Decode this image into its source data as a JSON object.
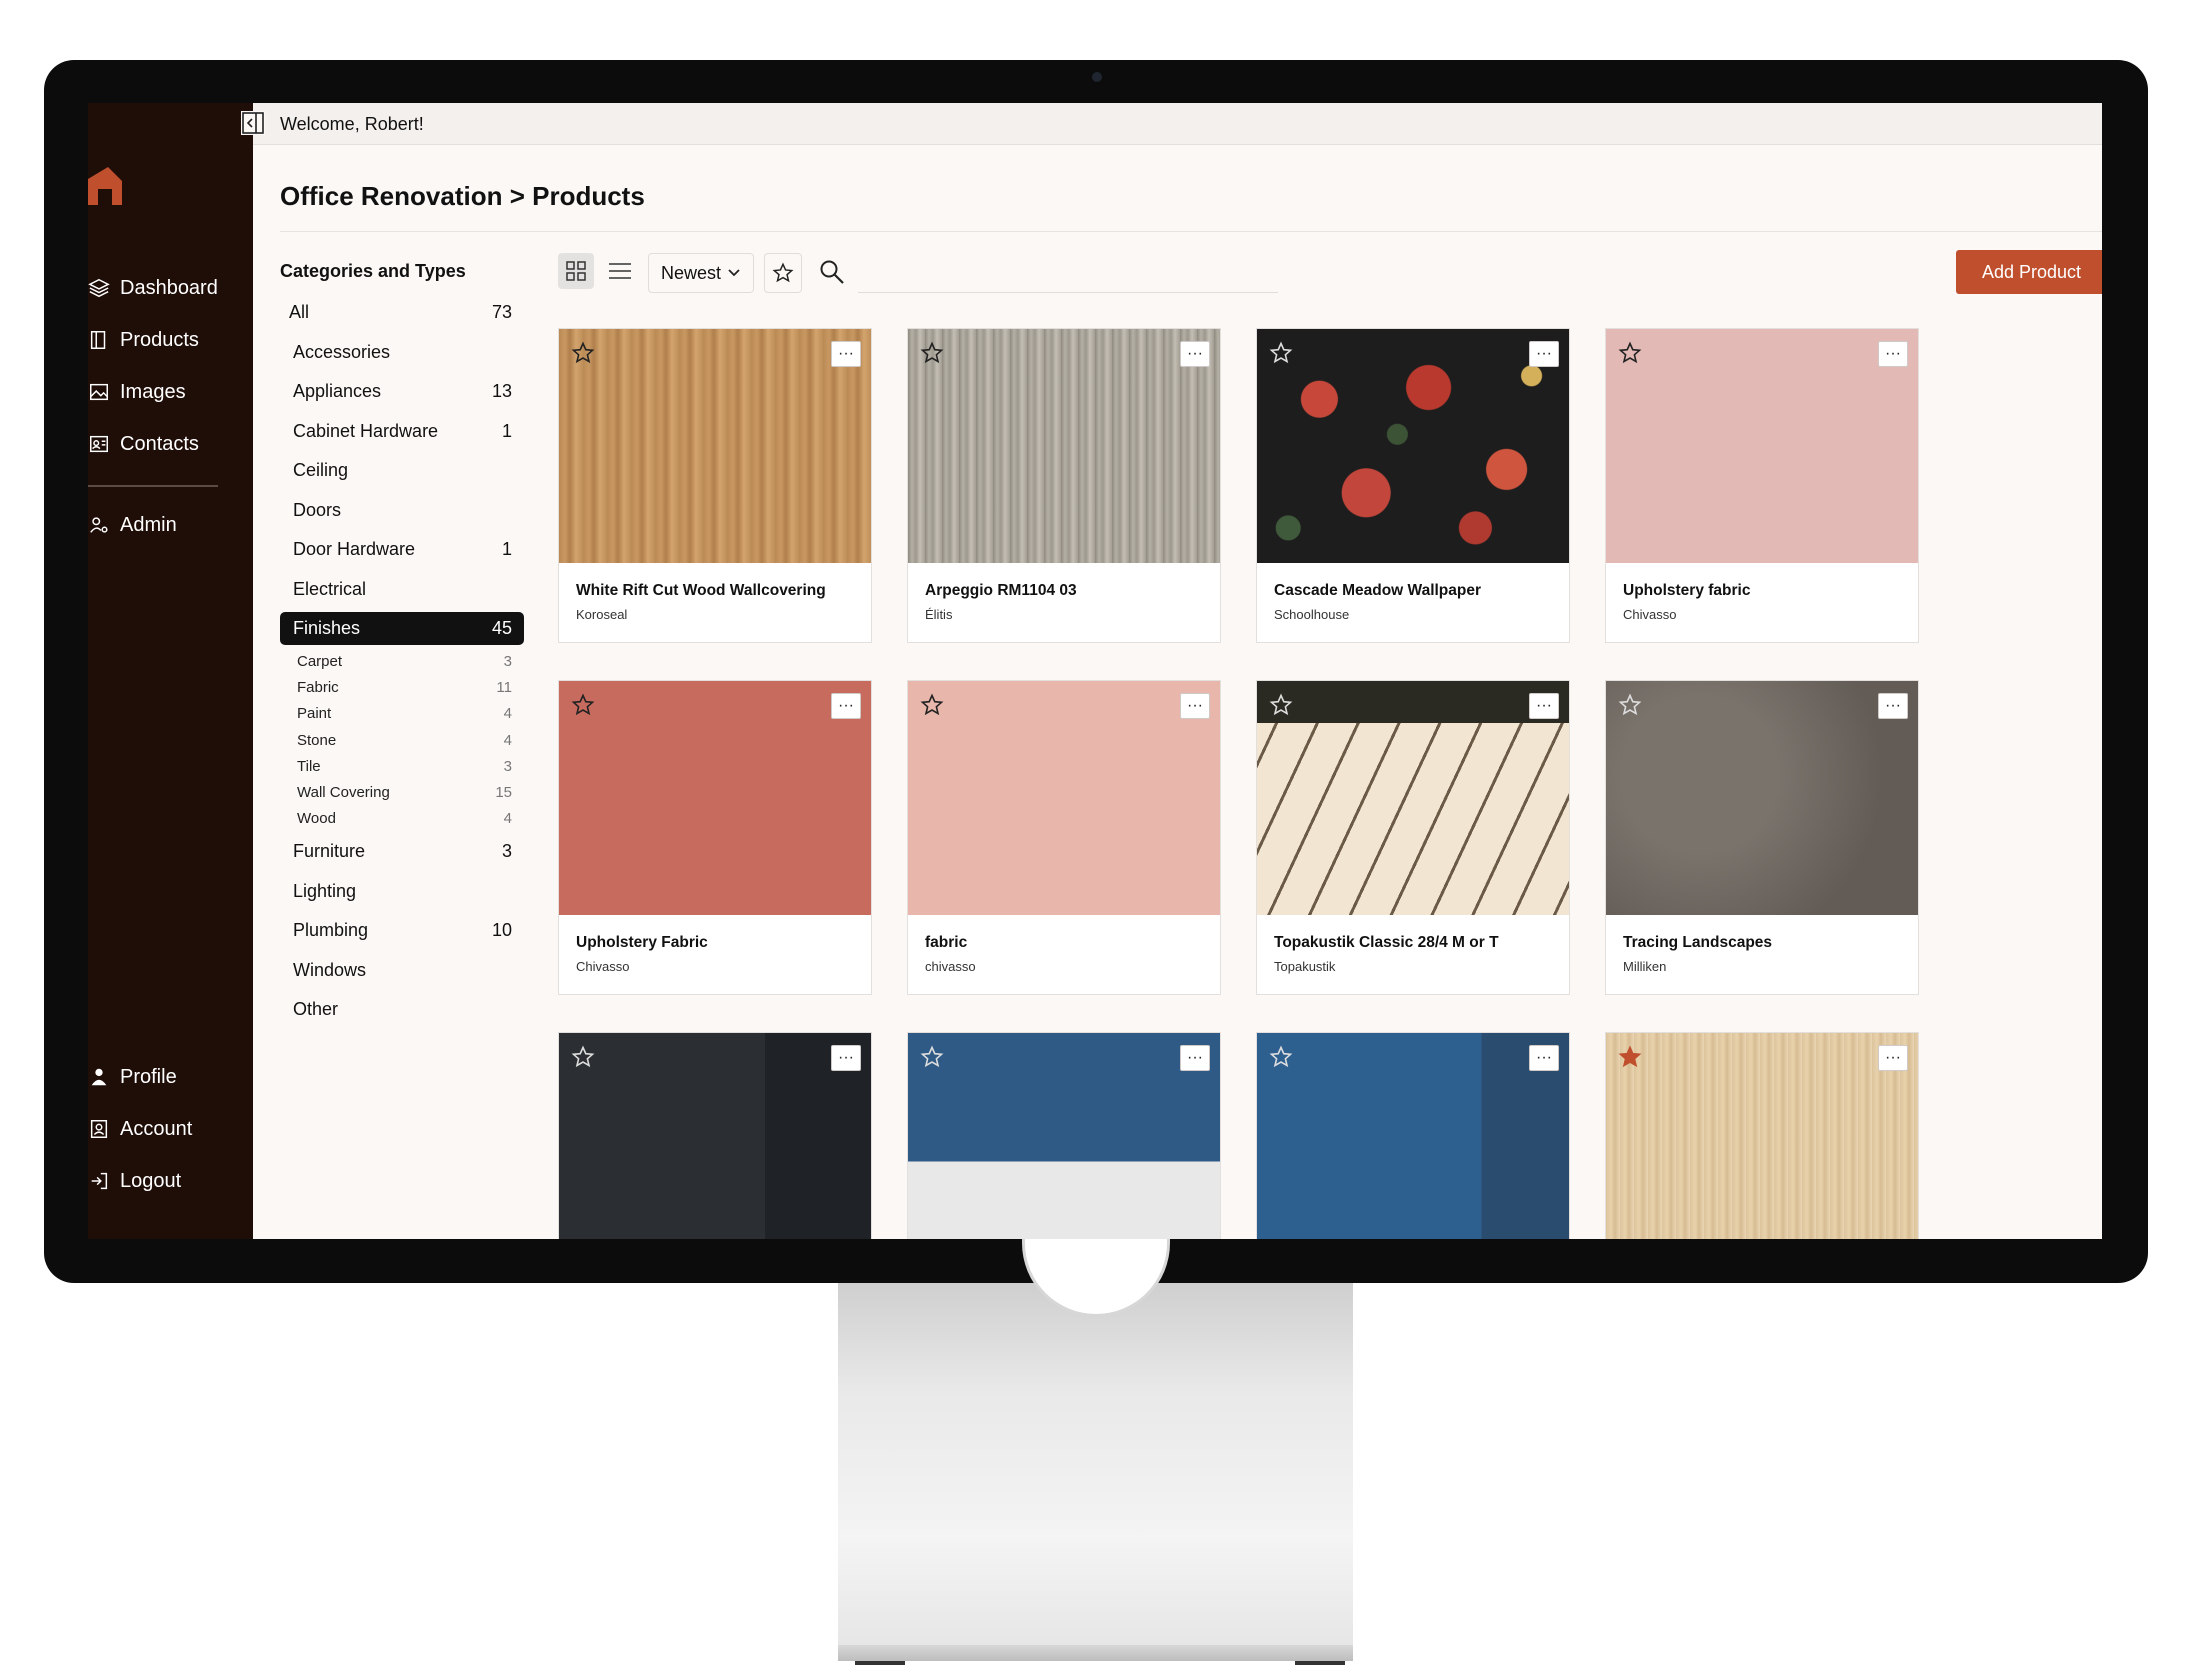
{
  "topbar": {
    "welcome": "Welcome, Robert!"
  },
  "sidebar": {
    "nav": [
      {
        "label": "Dashboard",
        "icon": "layers-icon"
      },
      {
        "label": "Products",
        "icon": "book-icon"
      },
      {
        "label": "Images",
        "icon": "image-icon"
      },
      {
        "label": "Contacts",
        "icon": "contact-card-icon"
      }
    ],
    "admin": {
      "label": "Admin",
      "icon": "users-gear-icon"
    },
    "bottom": [
      {
        "label": "Profile",
        "icon": "person-icon"
      },
      {
        "label": "Account",
        "icon": "account-icon"
      },
      {
        "label": "Logout",
        "icon": "logout-icon"
      }
    ]
  },
  "page": {
    "title": "Office Renovation > Products"
  },
  "categories": {
    "title": "Categories and Types",
    "items": [
      {
        "label": "All",
        "count": "73"
      },
      {
        "label": "Accessories",
        "count": ""
      },
      {
        "label": "Appliances",
        "count": "13"
      },
      {
        "label": "Cabinet Hardware",
        "count": "1"
      },
      {
        "label": "Ceiling",
        "count": ""
      },
      {
        "label": "Doors",
        "count": ""
      },
      {
        "label": "Door Hardware",
        "count": "1"
      },
      {
        "label": "Electrical",
        "count": ""
      },
      {
        "label": "Finishes",
        "count": "45"
      },
      {
        "label": "Furniture",
        "count": "3"
      },
      {
        "label": "Lighting",
        "count": ""
      },
      {
        "label": "Plumbing",
        "count": "10"
      },
      {
        "label": "Windows",
        "count": ""
      },
      {
        "label": "Other",
        "count": ""
      }
    ],
    "finishes_sub": [
      {
        "label": "Carpet",
        "count": "3"
      },
      {
        "label": "Fabric",
        "count": "11"
      },
      {
        "label": "Paint",
        "count": "4"
      },
      {
        "label": "Stone",
        "count": "4"
      },
      {
        "label": "Tile",
        "count": "3"
      },
      {
        "label": "Wall Covering",
        "count": "15"
      },
      {
        "label": "Wood",
        "count": "4"
      }
    ]
  },
  "toolbar": {
    "sort": "Newest",
    "search_placeholder": "",
    "add_label": "Add Product"
  },
  "colors": {
    "accent": "#c0502d",
    "sidebar": "#1f0d08",
    "starred": "#c0502d"
  },
  "products": [
    {
      "name": "White Rift Cut Wood Wallcovering",
      "brand": "Koroseal",
      "starred": false
    },
    {
      "name": "Arpeggio RM1104 03",
      "brand": "Élitis",
      "starred": false
    },
    {
      "name": "Cascade Meadow Wallpaper",
      "brand": "Schoolhouse",
      "starred": false
    },
    {
      "name": "Upholstery fabric",
      "brand": "Chivasso",
      "starred": false
    },
    {
      "name": "Upholstery Fabric",
      "brand": "Chivasso",
      "starred": false
    },
    {
      "name": "fabric",
      "brand": "chivasso",
      "starred": false
    },
    {
      "name": "Topakustik Classic 28/4 M or T",
      "brand": "Topakustik",
      "starred": false
    },
    {
      "name": "Tracing Landscapes",
      "brand": "Milliken",
      "starred": false
    },
    {
      "name": "",
      "brand": "",
      "starred": false
    },
    {
      "name": "",
      "brand": "",
      "starred": false
    },
    {
      "name": "",
      "brand": "",
      "starred": false
    },
    {
      "name": "",
      "brand": "",
      "starred": true
    }
  ]
}
